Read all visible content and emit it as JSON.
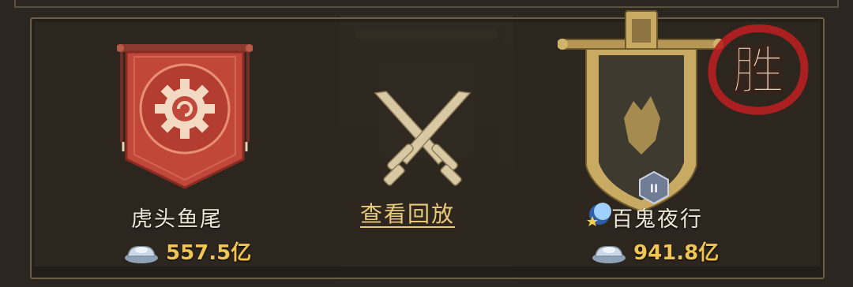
{
  "match": {
    "left_team": {
      "name": "虎头鱼尾",
      "funds": "557.5亿"
    },
    "right_team": {
      "name": "百鬼夜行",
      "funds": "941.8亿"
    },
    "replay_label": "查看回放",
    "result_stamp": "胜",
    "rank_badge": "II"
  },
  "colors": {
    "background": "#2b261f",
    "name_text": "#efe7d6",
    "replay_text": "#e9c978",
    "funds_text": "#f2c451",
    "left_banner": "#c0473a",
    "right_banner_trim": "#c9aa62",
    "stamp_red": "#b81f1f"
  },
  "icons": {
    "left_emblem": "gear-emblem-icon",
    "right_emblem": "wolf-emblem-icon",
    "vs": "crossed-swords-icon",
    "currency": "silver-ingot-icon",
    "team_tag": "moon-star-icon",
    "rank": "rank-ii-badge-icon"
  }
}
